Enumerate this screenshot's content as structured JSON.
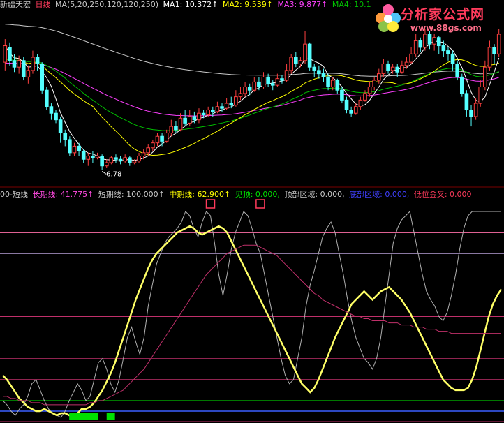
{
  "top_header": {
    "stock": "新疆天宏",
    "period": "日线",
    "ma_def": "MA(5,20,250,120,120,250)",
    "ma1": "MA1: 10.372↑",
    "ma2": "MA2: 9.539↑",
    "ma3": "MA3: 9.877↑",
    "ma4": "MA4: 10.1"
  },
  "indicator_header": {
    "name": "00-短线",
    "long": "长期线: 41.775↑",
    "short": "短期线: 100.000↑",
    "mid": "中期线: 62.900↑",
    "top_signal": "见顶: 0.000,",
    "top_zone": "顶部区域: 0.000,",
    "bottom_zone": "底部区域: 0.000,",
    "low_cross": "低位金叉: 0.000"
  },
  "logo": {
    "name": "分析家公式网",
    "url": "www.88gs.com"
  },
  "colors": {
    "up": "#ff4040",
    "down": "#54ffff",
    "ma1": "#ffffff",
    "ma2": "#ffff00",
    "ma3": "#ff40ff",
    "ma4": "#00c000",
    "ma_long": "#c8c8c8",
    "short": "#b0b0b0",
    "mid": "#ffff66",
    "long": "#c0306a",
    "label_white": "#c8c8c8",
    "label_pink": "#ff4ae0",
    "label_yellow": "#ffff00",
    "label_green": "#00e000",
    "label_blue": "#4040ff",
    "label_red": "#ff3b5c"
  },
  "chart_data": [
    {
      "type": "candlestick",
      "title": "新疆天宏 日线",
      "price_range": [
        6.3,
        11.6
      ],
      "annotations": [
        {
          "text": "6.78",
          "label": "low"
        }
      ],
      "candles": [
        [
          10.05,
          10.55,
          10.75,
          9.8
        ],
        [
          10.5,
          10.1,
          10.65,
          9.95
        ],
        [
          10.1,
          9.9,
          10.3,
          9.75
        ],
        [
          9.9,
          10.1,
          10.25,
          9.7
        ],
        [
          10.1,
          9.6,
          10.2,
          9.5
        ],
        [
          9.6,
          9.8,
          9.95,
          9.4
        ],
        [
          9.8,
          10.2,
          10.4,
          9.7
        ],
        [
          10.2,
          10.0,
          10.3,
          9.8
        ],
        [
          10.0,
          9.2,
          10.05,
          9.1
        ],
        [
          9.2,
          8.7,
          9.3,
          8.6
        ],
        [
          8.7,
          8.5,
          8.8,
          8.3
        ],
        [
          8.5,
          8.3,
          8.6,
          8.2
        ],
        [
          8.3,
          7.9,
          8.4,
          7.6
        ],
        [
          7.9,
          7.7,
          8.0,
          7.5
        ],
        [
          7.7,
          7.3,
          7.8,
          7.2
        ],
        [
          7.3,
          7.5,
          7.6,
          7.2
        ],
        [
          7.5,
          7.35,
          7.6,
          7.2
        ],
        [
          7.35,
          7.1,
          7.4,
          7.0
        ],
        [
          7.1,
          7.2,
          7.3,
          6.9
        ],
        [
          7.2,
          7.15,
          7.35,
          7.0
        ],
        [
          7.15,
          7.2,
          7.3,
          7.1
        ],
        [
          7.2,
          6.9,
          7.25,
          6.78
        ],
        [
          6.9,
          7.0,
          7.1,
          6.85
        ],
        [
          7.0,
          7.15,
          7.2,
          6.95
        ],
        [
          7.15,
          7.1,
          7.25,
          7.0
        ],
        [
          7.1,
          7.05,
          7.2,
          6.95
        ],
        [
          7.05,
          7.15,
          7.25,
          7.0
        ],
        [
          7.15,
          7.0,
          7.2,
          6.9
        ],
        [
          7.0,
          7.05,
          7.1,
          6.95
        ],
        [
          7.05,
          7.2,
          7.3,
          7.0
        ],
        [
          7.2,
          7.3,
          7.4,
          7.1
        ],
        [
          7.3,
          7.45,
          7.55,
          7.2
        ],
        [
          7.45,
          7.6,
          7.7,
          7.35
        ],
        [
          7.6,
          7.8,
          7.9,
          7.5
        ],
        [
          7.8,
          7.65,
          7.9,
          7.5
        ],
        [
          7.65,
          7.9,
          8.0,
          7.6
        ],
        [
          7.9,
          8.1,
          8.3,
          7.8
        ],
        [
          8.1,
          8.0,
          8.25,
          7.9
        ],
        [
          8.0,
          8.35,
          8.5,
          7.95
        ],
        [
          8.35,
          8.2,
          8.6,
          8.1
        ],
        [
          8.2,
          8.4,
          8.6,
          8.1
        ],
        [
          8.4,
          8.3,
          8.55,
          8.2
        ],
        [
          8.3,
          8.5,
          8.65,
          8.2
        ],
        [
          8.5,
          8.45,
          8.6,
          8.35
        ],
        [
          8.45,
          8.6,
          8.7,
          8.4
        ],
        [
          8.6,
          8.55,
          8.7,
          8.4
        ],
        [
          8.55,
          8.7,
          8.85,
          8.5
        ],
        [
          8.7,
          8.65,
          8.8,
          8.55
        ],
        [
          8.65,
          8.8,
          8.95,
          8.6
        ],
        [
          8.8,
          8.75,
          9.0,
          8.65
        ],
        [
          8.75,
          9.0,
          9.2,
          8.7
        ],
        [
          9.0,
          9.1,
          9.3,
          8.9
        ],
        [
          9.1,
          9.3,
          9.45,
          9.0
        ],
        [
          9.3,
          9.2,
          9.4,
          9.05
        ],
        [
          9.2,
          9.45,
          9.6,
          9.15
        ],
        [
          9.45,
          9.3,
          9.6,
          9.2
        ],
        [
          9.3,
          9.6,
          9.75,
          9.25
        ],
        [
          9.6,
          9.4,
          9.7,
          9.3
        ],
        [
          9.4,
          9.35,
          9.5,
          9.2
        ],
        [
          9.35,
          9.55,
          9.7,
          9.3
        ],
        [
          9.55,
          9.5,
          9.65,
          9.4
        ],
        [
          9.5,
          9.8,
          10.0,
          9.45
        ],
        [
          9.8,
          10.2,
          10.3,
          9.7
        ],
        [
          10.2,
          10.0,
          10.35,
          9.9
        ],
        [
          10.0,
          10.1,
          10.2,
          9.9
        ],
        [
          10.1,
          10.6,
          11.0,
          10.0
        ],
        [
          10.6,
          9.9,
          10.65,
          9.8
        ],
        [
          9.9,
          9.8,
          10.0,
          9.6
        ],
        [
          9.8,
          9.7,
          9.95,
          9.55
        ],
        [
          9.7,
          9.6,
          9.85,
          9.45
        ],
        [
          9.6,
          9.3,
          9.7,
          9.2
        ],
        [
          9.3,
          9.5,
          9.6,
          9.2
        ],
        [
          9.5,
          9.2,
          9.55,
          9.1
        ],
        [
          9.2,
          8.9,
          9.3,
          8.8
        ],
        [
          8.9,
          8.6,
          9.0,
          8.5
        ],
        [
          8.6,
          8.5,
          8.7,
          8.4
        ],
        [
          8.5,
          8.7,
          8.8,
          8.45
        ],
        [
          8.7,
          8.9,
          9.0,
          8.6
        ],
        [
          8.9,
          9.1,
          9.2,
          8.85
        ],
        [
          9.1,
          9.3,
          9.45,
          9.0
        ],
        [
          9.3,
          9.5,
          9.6,
          9.2
        ],
        [
          9.5,
          9.7,
          9.85,
          9.4
        ],
        [
          9.7,
          10.0,
          10.15,
          9.6
        ],
        [
          10.0,
          9.8,
          10.1,
          9.7
        ],
        [
          9.8,
          9.9,
          10.0,
          9.7
        ],
        [
          9.9,
          9.75,
          10.0,
          9.6
        ],
        [
          9.75,
          9.95,
          10.1,
          9.7
        ],
        [
          9.95,
          10.05,
          10.2,
          9.85
        ],
        [
          10.05,
          10.3,
          10.5,
          10.0
        ],
        [
          10.3,
          10.7,
          10.9,
          10.2
        ],
        [
          10.7,
          10.5,
          10.8,
          10.35
        ],
        [
          10.5,
          10.9,
          11.05,
          10.4
        ],
        [
          10.9,
          10.6,
          11.0,
          10.45
        ],
        [
          10.6,
          10.8,
          10.9,
          10.4
        ],
        [
          10.8,
          10.55,
          10.85,
          10.3
        ],
        [
          10.55,
          10.4,
          10.7,
          10.2
        ],
        [
          10.4,
          10.3,
          10.5,
          10.1
        ],
        [
          10.3,
          10.0,
          10.4,
          9.8
        ],
        [
          10.0,
          9.6,
          10.1,
          9.5
        ],
        [
          9.6,
          9.1,
          9.7,
          9.0
        ],
        [
          9.1,
          8.6,
          9.2,
          8.4
        ],
        [
          8.6,
          8.4,
          8.75,
          8.1
        ],
        [
          8.4,
          8.8,
          8.95,
          8.3
        ],
        [
          8.8,
          9.3,
          9.5,
          8.7
        ],
        [
          9.3,
          9.9,
          10.1,
          9.2
        ],
        [
          9.9,
          10.5,
          10.7,
          9.8
        ],
        [
          10.5,
          10.3,
          10.6,
          10.0
        ],
        [
          10.3,
          10.9,
          11.05,
          10.2
        ]
      ]
    },
    {
      "type": "line",
      "title": "00-短线",
      "ylim": [
        0,
        105
      ],
      "reference_levels": [
        0,
        5,
        10,
        20,
        30,
        50,
        80,
        90
      ],
      "series": [
        {
          "name": "短期线",
          "values": [
            10,
            8,
            5,
            3,
            6,
            8,
            12,
            18,
            20,
            15,
            10,
            6,
            4,
            3,
            2,
            5,
            10,
            14,
            18,
            15,
            10,
            12,
            20,
            28,
            30,
            25,
            18,
            14,
            20,
            30,
            40,
            45,
            38,
            32,
            40,
            55,
            65,
            75,
            80,
            85,
            88,
            90,
            92,
            95,
            100,
            98,
            92,
            88,
            95,
            100,
            98,
            85,
            70,
            60,
            70,
            82,
            90,
            95,
            100,
            98,
            92,
            85,
            80,
            70,
            60,
            50,
            40,
            30,
            22,
            18,
            20,
            30,
            40,
            55,
            65,
            72,
            80,
            88,
            92,
            95,
            90,
            80,
            70,
            58,
            48,
            40,
            35,
            30,
            28,
            25,
            30,
            40,
            55,
            70,
            85,
            92,
            96,
            98,
            100,
            90,
            80,
            70,
            62,
            58,
            55,
            50,
            48,
            52,
            60,
            70,
            82,
            92,
            98,
            100,
            100,
            100,
            100,
            100,
            100,
            100,
            100
          ]
        },
        {
          "name": "中期线",
          "values": [
            22,
            20,
            17,
            14,
            11,
            9,
            7,
            6,
            5,
            5,
            6,
            5,
            4,
            3,
            4,
            4,
            3,
            3,
            4,
            6,
            6,
            7,
            9,
            12,
            15,
            19,
            23,
            28,
            34,
            40,
            46,
            52,
            58,
            63,
            68,
            73,
            77,
            80,
            82,
            84,
            86,
            88,
            90,
            91,
            92,
            93,
            92,
            90,
            89,
            90,
            91,
            92,
            93,
            92,
            90,
            86,
            82,
            78,
            74,
            70,
            66,
            62,
            58,
            54,
            50,
            46,
            42,
            38,
            34,
            30,
            26,
            22,
            18,
            16,
            14,
            16,
            20,
            25,
            30,
            35,
            40,
            44,
            48,
            52,
            56,
            58,
            60,
            62,
            60,
            58,
            60,
            62,
            63,
            64,
            62,
            60,
            58,
            55,
            52,
            48,
            44,
            40,
            36,
            32,
            28,
            24,
            20,
            18,
            16,
            15,
            15,
            15,
            16,
            20,
            26,
            34,
            42,
            50,
            56,
            60,
            63
          ]
        },
        {
          "name": "长期线",
          "values": [
            12,
            12,
            11,
            11,
            10,
            10,
            10,
            9,
            9,
            9,
            8,
            8,
            8,
            8,
            8,
            8,
            8,
            8,
            8,
            8,
            8,
            9,
            9,
            10,
            10,
            11,
            12,
            13,
            14,
            15,
            17,
            19,
            21,
            23,
            25,
            28,
            31,
            34,
            37,
            40,
            43,
            46,
            49,
            52,
            55,
            58,
            61,
            64,
            67,
            70,
            72,
            74,
            76,
            78,
            80,
            81,
            82,
            83,
            84,
            84,
            84,
            84,
            83,
            82,
            81,
            80,
            79,
            77,
            75,
            73,
            71,
            69,
            67,
            65,
            63,
            61,
            60,
            58,
            57,
            56,
            55,
            54,
            53,
            52,
            51,
            50,
            50,
            49,
            49,
            48,
            48,
            48,
            48,
            47,
            47,
            47,
            46,
            46,
            46,
            45,
            45,
            45,
            44,
            44,
            44,
            43,
            43,
            43,
            42,
            42,
            42,
            42,
            42,
            42,
            42,
            42,
            42,
            42,
            42,
            42,
            42
          ]
        }
      ],
      "markers": [
        {
          "label": "见顶",
          "index": 50
        },
        {
          "label": "见顶",
          "index": 62
        }
      ],
      "signals": [
        {
          "label": "底部区域",
          "start": 16,
          "end": 23
        },
        {
          "label": "底部区域",
          "start": 25,
          "end": 27
        }
      ]
    }
  ]
}
